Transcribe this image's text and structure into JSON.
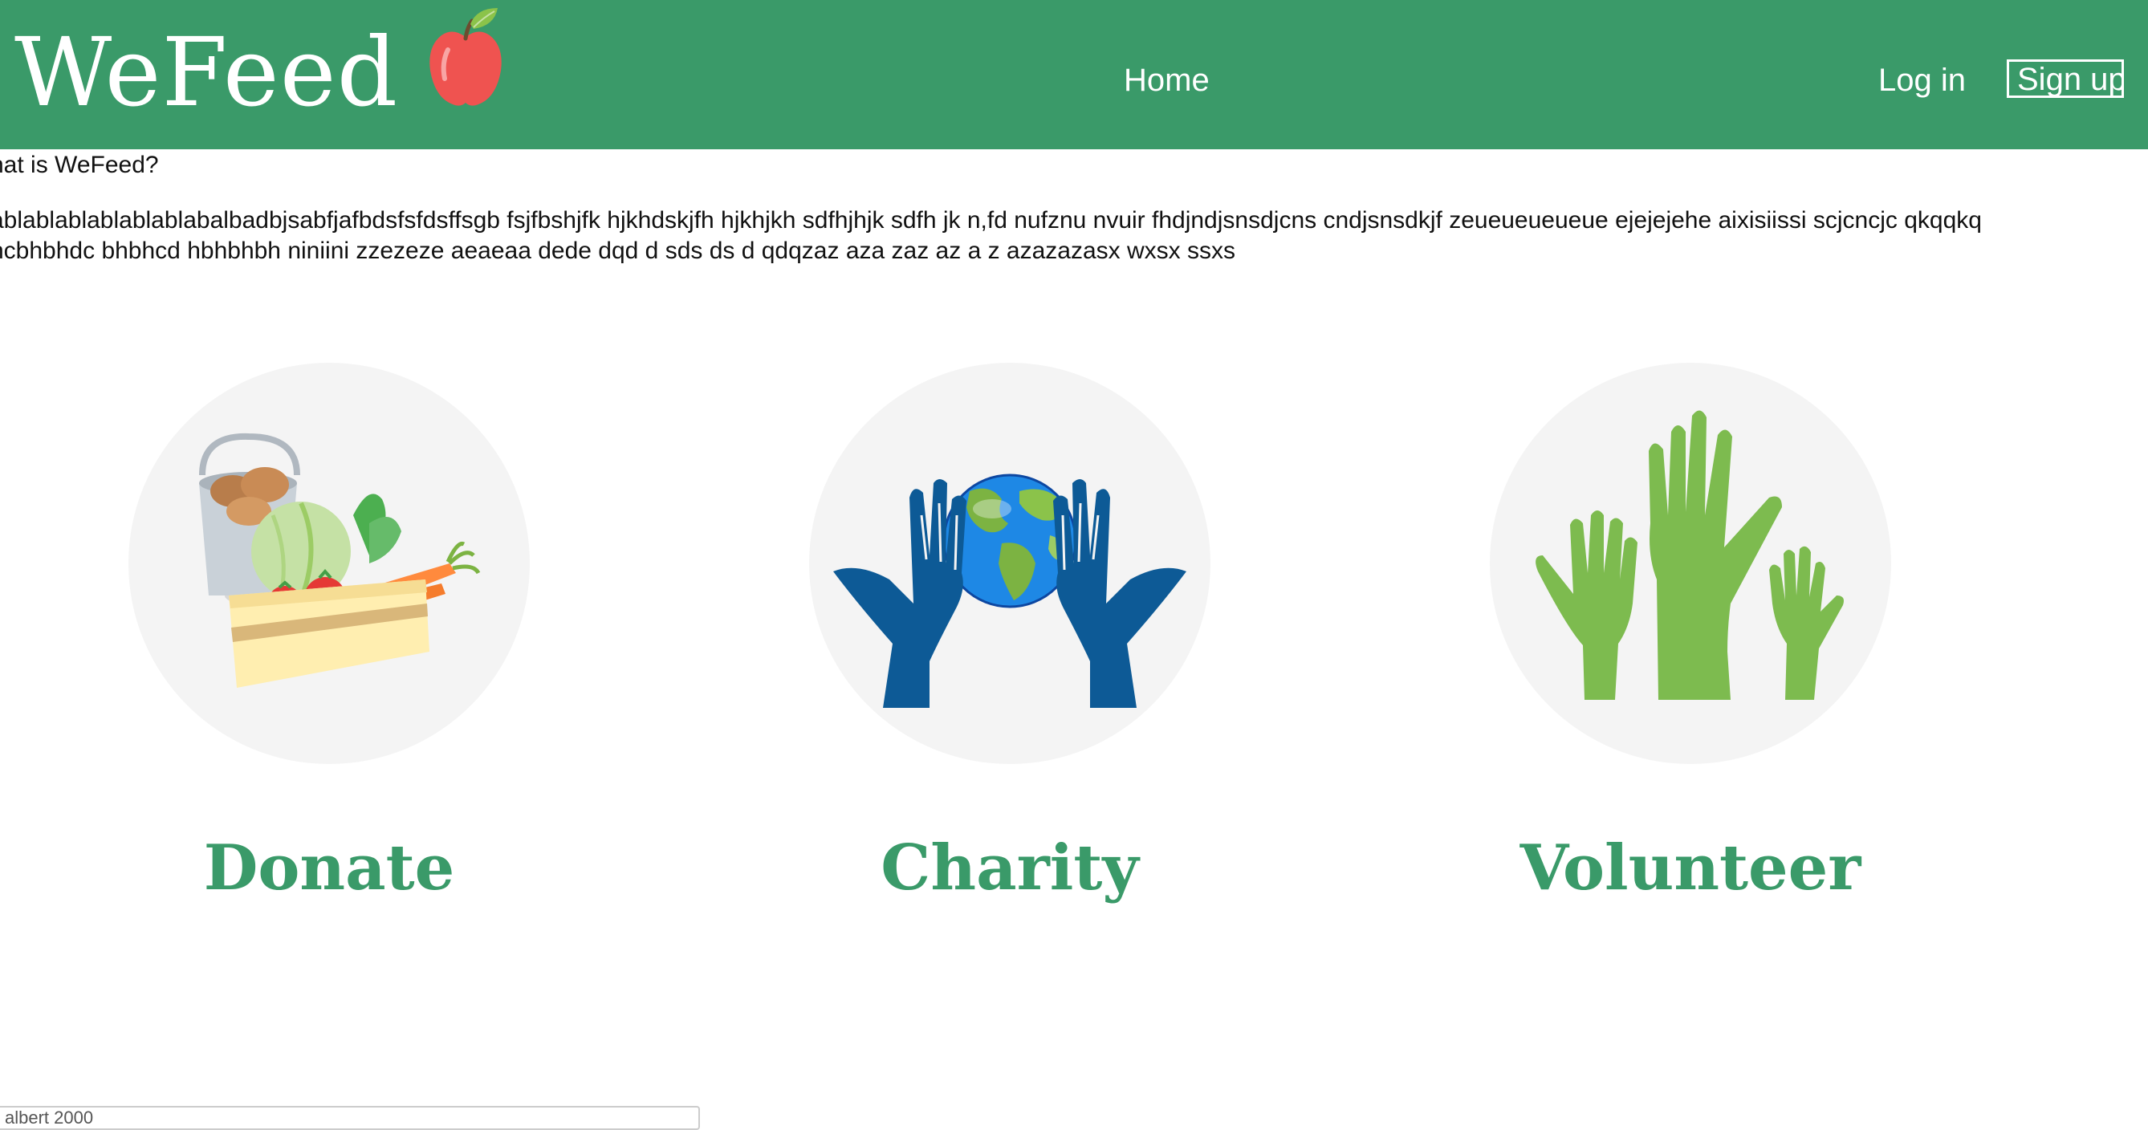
{
  "nav": {
    "brand": "WeFeed",
    "home": "Home",
    "login": "Log in",
    "signup": "Sign up",
    "bg_color": "#3a9a69"
  },
  "about": {
    "heading": "hat is WeFeed?",
    "body": "ablablablablablablabalbadbjsabfjafbdsfsfdsffsgb fsjfbshjfk hjkhdskjfh hjkhjkh sdfhjhjk sdfh jk n,fd nufznu nvuir fhdjndjsnsdjcns cndjsnsdkjf zeueueueueue ejejejehe aixisiissi scjcncjc qkqqkq\nncbhbhdc bhbhcd hbhbhbh niniini zzezeze aeaeaa dede dqd d sds ds d qdqzaz aza zaz az a z azazazasx wxsx ssxs"
  },
  "features": [
    {
      "label": "Donate",
      "icon": "food-basket-icon"
    },
    {
      "label": "Charity",
      "icon": "earth-in-hands-icon"
    },
    {
      "label": "Volunteer",
      "icon": "raised-hands-icon"
    }
  ],
  "footer": {
    "text": "albert 2000"
  }
}
